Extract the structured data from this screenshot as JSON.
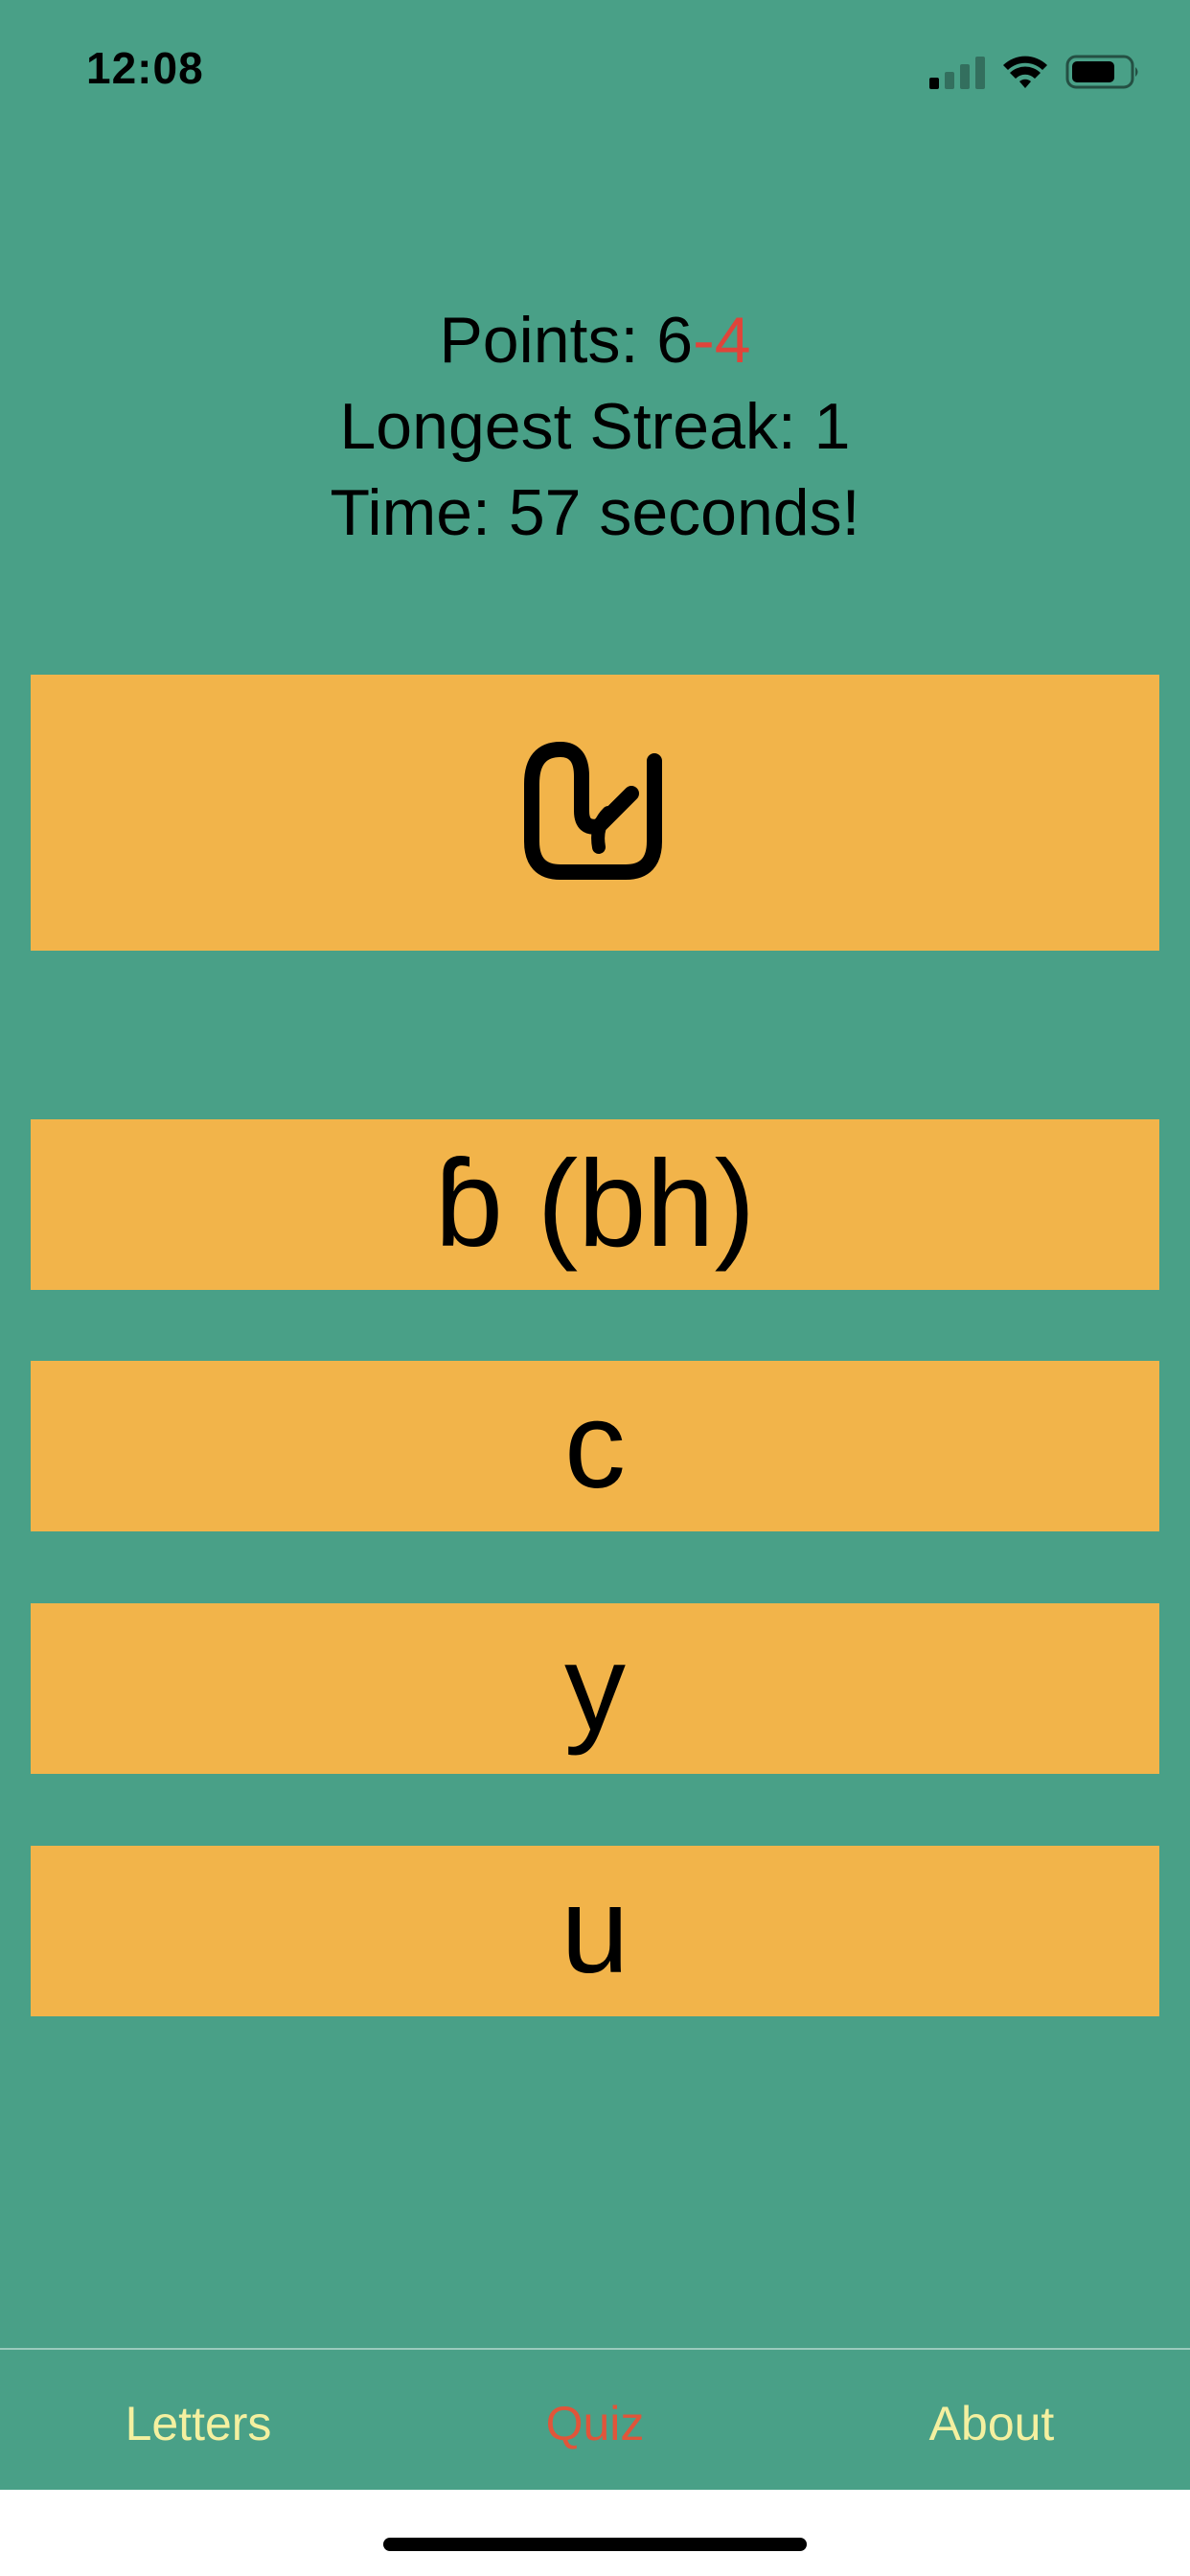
{
  "status_bar": {
    "time": "12:08",
    "icons": [
      "cellular-signal-icon",
      "wifi-icon",
      "battery-icon"
    ]
  },
  "score": {
    "points_label": "Points: 6",
    "points_penalty": "-4",
    "longest_streak": "Longest Streak: 1",
    "time": "Time: 57 seconds!"
  },
  "question": {
    "glyph_icon": "script-letter-glyph"
  },
  "answers": [
    "ɓ (bh)",
    "c",
    "y",
    "u"
  ],
  "tabs": [
    {
      "label": "Letters",
      "active": false
    },
    {
      "label": "Quiz",
      "active": true
    },
    {
      "label": "About",
      "active": false
    }
  ],
  "colors": {
    "background": "#49a087",
    "card": "#f2b44a",
    "penalty": "#e0443a",
    "tab_inactive": "#f4f0a0",
    "tab_active": "#e0553a"
  }
}
